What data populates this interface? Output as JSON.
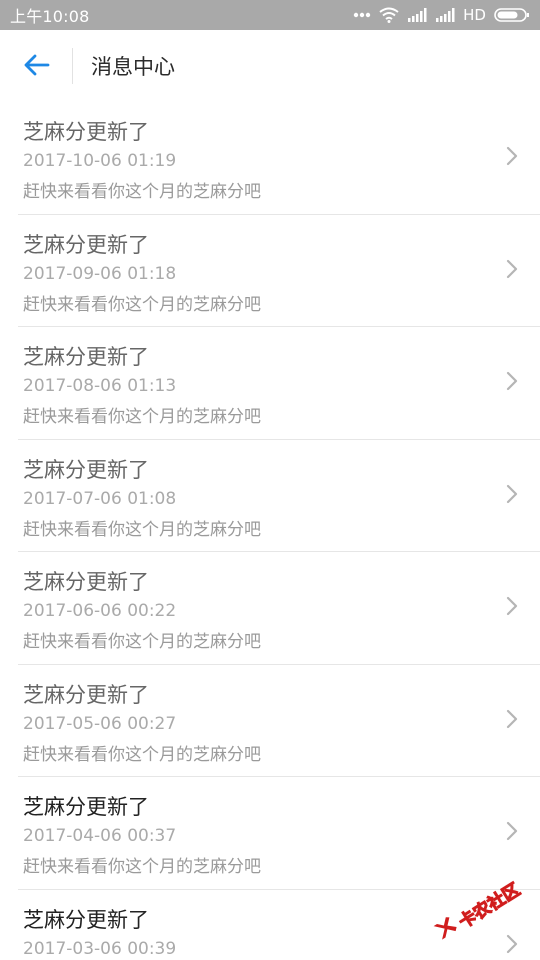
{
  "status_bar": {
    "time": "上午10:08",
    "network_label": "HD",
    "icons": [
      "more-dots-icon",
      "wifi-icon",
      "signal-icon",
      "signal-icon",
      "battery-icon"
    ]
  },
  "header": {
    "title": "消息中心",
    "back_icon": "arrow-left-icon",
    "accent_color": "#1e88e5"
  },
  "messages": [
    {
      "title": "芝麻分更新了",
      "time": "2017-10-06 01:19",
      "desc": "赶快来看看你这个月的芝麻分吧",
      "read": true
    },
    {
      "title": "芝麻分更新了",
      "time": "2017-09-06 01:18",
      "desc": "赶快来看看你这个月的芝麻分吧",
      "read": true
    },
    {
      "title": "芝麻分更新了",
      "time": "2017-08-06 01:13",
      "desc": "赶快来看看你这个月的芝麻分吧",
      "read": true
    },
    {
      "title": "芝麻分更新了",
      "time": "2017-07-06 01:08",
      "desc": "赶快来看看你这个月的芝麻分吧",
      "read": true
    },
    {
      "title": "芝麻分更新了",
      "time": "2017-06-06 00:22",
      "desc": "赶快来看看你这个月的芝麻分吧",
      "read": true
    },
    {
      "title": "芝麻分更新了",
      "time": "2017-05-06 00:27",
      "desc": "赶快来看看你这个月的芝麻分吧",
      "read": true
    },
    {
      "title": "芝麻分更新了",
      "time": "2017-04-06 00:37",
      "desc": "赶快来看看你这个月的芝麻分吧",
      "read": false
    },
    {
      "title": "芝麻分更新了",
      "time": "2017-03-06 00:39",
      "desc": "",
      "read": false
    }
  ],
  "watermark": {
    "text": "卡农社区",
    "color": "#d01d1d"
  }
}
